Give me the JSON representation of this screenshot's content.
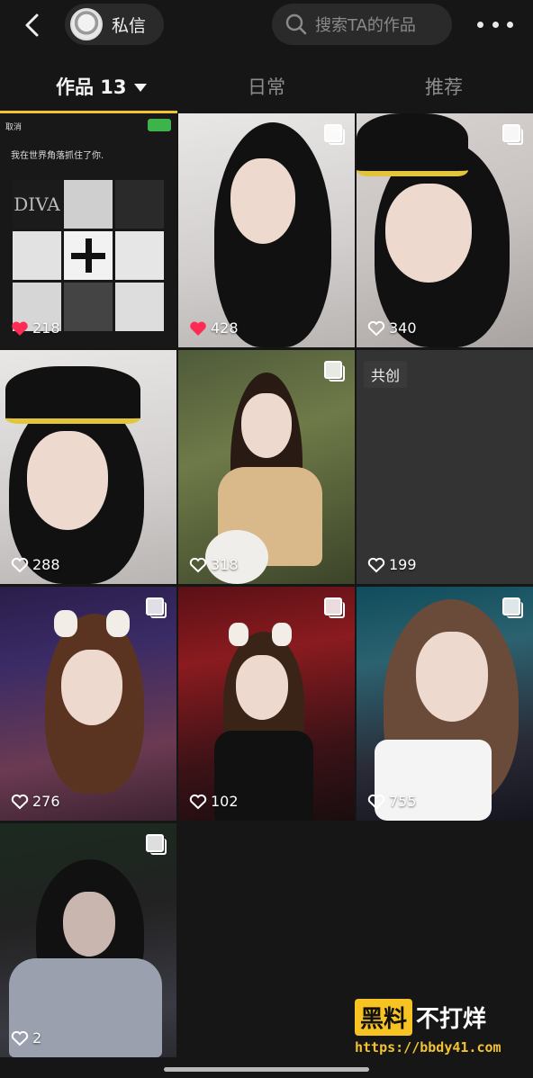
{
  "topbar": {
    "dm_label": "私信",
    "search_placeholder": "搜索TA的作品"
  },
  "tabs": [
    {
      "label": "作品 13",
      "active": true
    },
    {
      "label": "日常",
      "active": false
    },
    {
      "label": "推荐",
      "active": false
    }
  ],
  "grid": {
    "items": [
      {
        "likes": "218",
        "liked": true,
        "multi": false,
        "collage": true
      },
      {
        "likes": "428",
        "liked": true,
        "multi": true
      },
      {
        "likes": "340",
        "liked": false,
        "multi": true
      },
      {
        "likes": "288",
        "liked": false,
        "multi": false
      },
      {
        "likes": "318",
        "liked": false,
        "multi": true
      },
      {
        "likes": "199",
        "liked": false,
        "multi": false,
        "label": "共创"
      },
      {
        "likes": "276",
        "liked": false,
        "multi": true
      },
      {
        "likes": "102",
        "liked": false,
        "multi": true
      },
      {
        "likes": "755",
        "liked": false,
        "multi": true
      },
      {
        "likes": "2",
        "liked": false,
        "multi": true
      }
    ]
  },
  "collage": {
    "header": "取消",
    "caption": "我在世界角落抓住了你.",
    "diva": "DIVA"
  },
  "watermark": {
    "badge": "黑料",
    "text": "不打烊",
    "url": "https://bbdy41.com"
  },
  "colors": {
    "accent": "#f2c233",
    "like_red": "#fe2c55",
    "background": "#161616"
  }
}
